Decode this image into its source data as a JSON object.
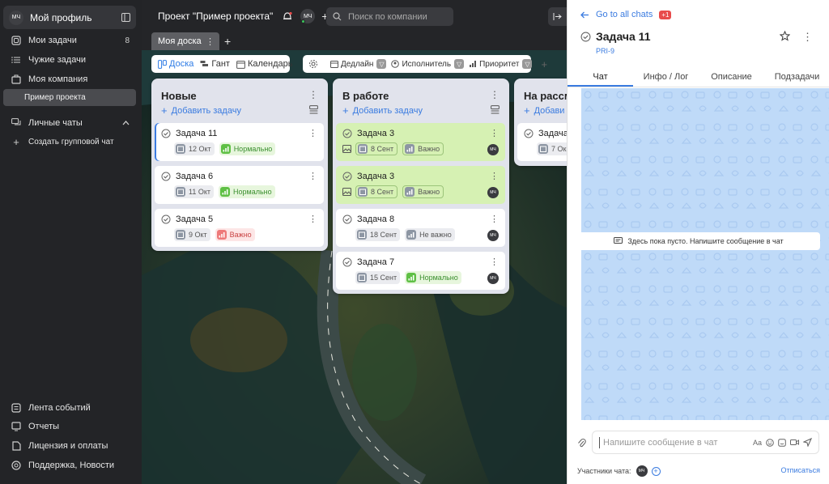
{
  "sidebar": {
    "profile": {
      "initials": "МЧ",
      "name": "Мой профиль"
    },
    "items": [
      {
        "label": "Мои задачи",
        "count": "8"
      },
      {
        "label": "Чужие задачи"
      },
      {
        "label": "Моя компания"
      }
    ],
    "sub_item": "Пример проекта",
    "personal_chats": "Личные чаты",
    "create_group_chat": "Создать групповой чат",
    "bottom": [
      {
        "label": "Лента событий"
      },
      {
        "label": "Отчеты"
      },
      {
        "label": "Лицензия и оплаты"
      },
      {
        "label": "Поддержка, Новости"
      }
    ]
  },
  "topbar": {
    "project_title": "Проект \"Пример проекта\"",
    "user_initials": "МЧ",
    "search_placeholder": "Поиск по компании"
  },
  "board_tab": "Моя доска",
  "views": {
    "board": "Доска",
    "gantt": "Гант",
    "calendar": "Календарь"
  },
  "filters": {
    "deadline": "Дедлайн",
    "assignee": "Исполнитель",
    "priority": "Приоритет"
  },
  "columns": [
    {
      "title": "Новые",
      "add_label": "Добавить задачу",
      "cards": [
        {
          "title": "Задача 11",
          "date": "12 Окт",
          "priority": "Нормально"
        },
        {
          "title": "Задача 6",
          "date": "11 Окт",
          "priority": "Нормально"
        },
        {
          "title": "Задача 5",
          "date": "9 Окт",
          "priority": "Важно"
        }
      ]
    },
    {
      "title": "В работе",
      "add_label": "Добавить задачу",
      "cards": [
        {
          "title": "Задача 3",
          "date": "8 Сент",
          "priority": "Важно",
          "assignee": "МЧ"
        },
        {
          "title": "Задача 3",
          "date": "8 Сент",
          "priority": "Важно",
          "assignee": "МЧ"
        },
        {
          "title": "Задача 8",
          "date": "18 Сент",
          "priority": "Не важно",
          "assignee": "МЧ"
        },
        {
          "title": "Задача 7",
          "date": "15 Сент",
          "priority": "Нормально",
          "assignee": "МЧ"
        }
      ]
    },
    {
      "title": "На рассм",
      "add_label": "Добави",
      "cards": [
        {
          "title": "Задача",
          "date": "7 Ок"
        }
      ]
    }
  ],
  "panel": {
    "back_label": "Go to all chats",
    "badge": "+1",
    "task_title": "Задача 11",
    "task_code": "PRI-9",
    "tabs": [
      "Чат",
      "Инфо / Лог",
      "Описание",
      "Подзадачи"
    ],
    "empty_message": "Здесь пока пусто. Напишите сообщение в чат",
    "composer_placeholder": "Напишите сообщение в чат",
    "format_label": "Aa",
    "members_label": "Участники чата:",
    "member_initials": "МЧ",
    "unsubscribe": "Отписаться"
  },
  "colors": {
    "accent": "#3a7be0",
    "sidebar_bg": "#232427",
    "green_card": "#d6f1b3",
    "chat_bg": "#bfdaf8"
  }
}
